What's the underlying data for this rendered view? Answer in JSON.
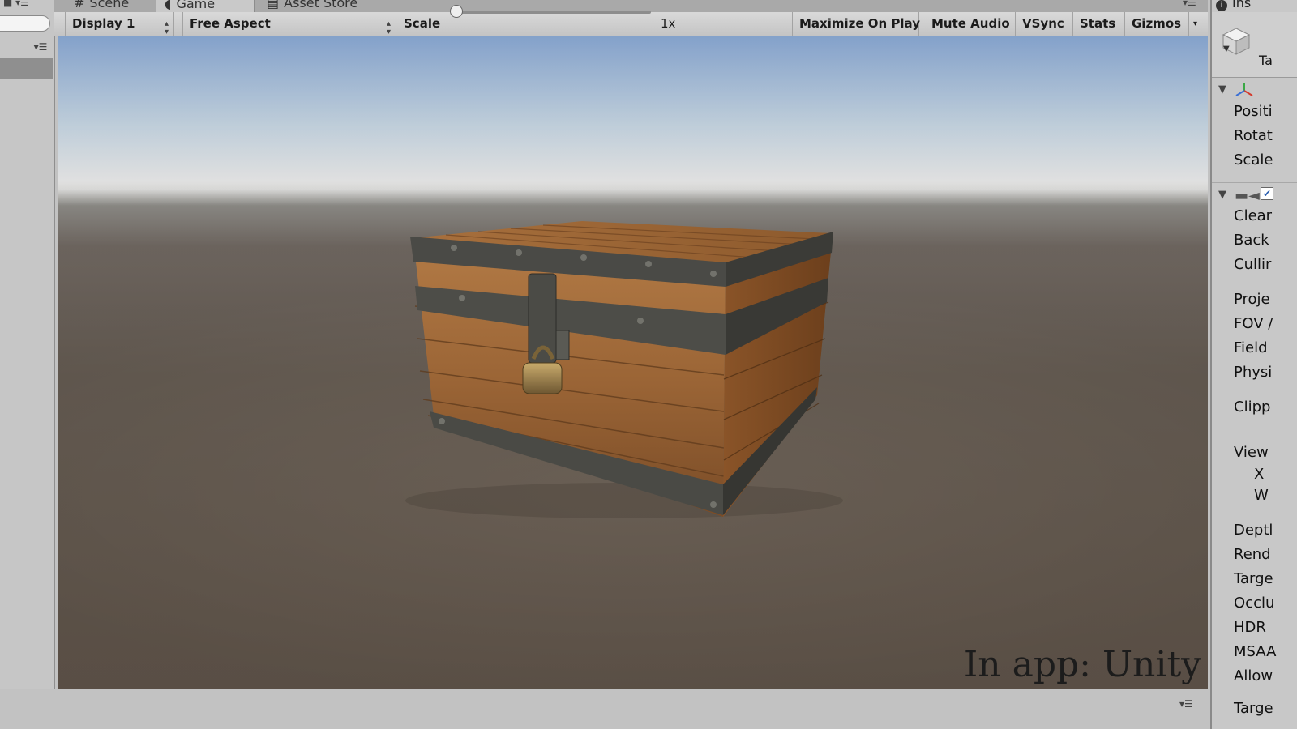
{
  "tabs": [
    {
      "label": "Scene",
      "icon": "hash-icon"
    },
    {
      "label": "Game",
      "icon": "pacman-icon"
    },
    {
      "label": "Asset Store",
      "icon": "store-icon"
    }
  ],
  "toolbar": {
    "display": "Display 1",
    "aspect": "Free Aspect",
    "scale_label": "Scale",
    "scale_value": "1x",
    "maximize": "Maximize On Play",
    "mute": "Mute Audio",
    "vsync": "VSync",
    "stats": "Stats",
    "gizmos": "Gizmos"
  },
  "watermark": "In app: Unity",
  "inspector": {
    "tab": "Ins",
    "tag": "Ta",
    "transform": [
      "Positi",
      "Rotat",
      "Scale"
    ],
    "camera": [
      "Clear",
      "Back",
      "Cullir",
      "Proje",
      "FOV /",
      "Field",
      "Physi",
      "Clipp",
      "View",
      "X",
      "W",
      "Deptl",
      "Rend",
      "Targe",
      "Occlu",
      "HDR",
      "MSAA",
      "Allow",
      "Targe"
    ]
  },
  "colors": {
    "sky_top": "#95b7e6",
    "ground": "#6b6157",
    "toolbar": "#d0d0d0"
  }
}
